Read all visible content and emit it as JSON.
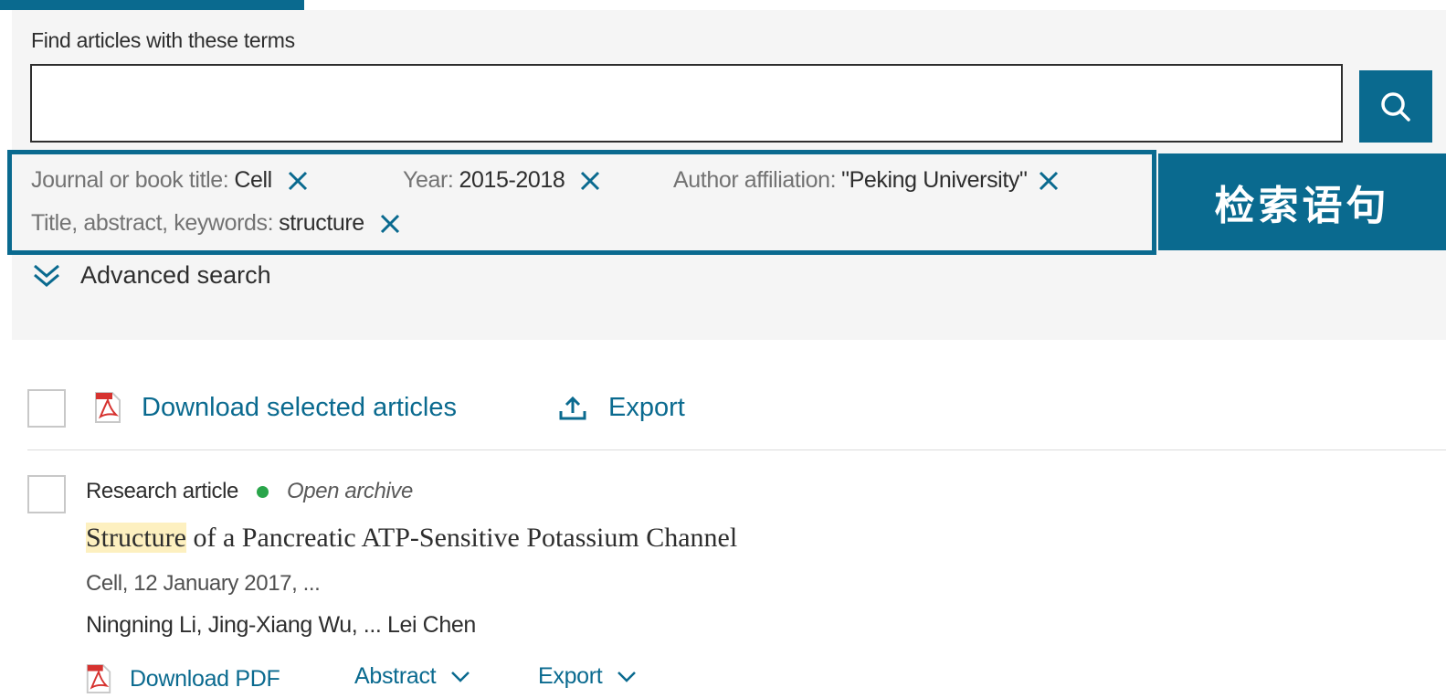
{
  "search": {
    "label": "Find articles with these terms",
    "value": "",
    "placeholder": ""
  },
  "query_chips": [
    {
      "key": "Journal or book title:",
      "value": "Cell"
    },
    {
      "key": "Year:",
      "value": "2015-2018"
    },
    {
      "key": "Author affiliation:",
      "value": "\"Peking University\""
    },
    {
      "key": "Title, abstract, keywords:",
      "value": "structure"
    }
  ],
  "callout": "检索语句",
  "advanced_search_label": "Advanced search",
  "toolbar": {
    "download_label": "Download selected articles",
    "export_label": "Export"
  },
  "result": {
    "type": "Research article",
    "access": "Open archive",
    "title_highlight": "Structure",
    "title_rest": " of a Pancreatic ATP-Sensitive Potassium Channel",
    "source": "Cell, 12 January 2017, ...",
    "authors": "Ningning Li, Jing-Xiang Wu, ... Lei Chen",
    "download_pdf_label": "Download PDF",
    "abstract_label": "Abstract",
    "export_label": "Export"
  },
  "colors": {
    "brand": "#0a6a8f",
    "open_access_dot": "#29a54a",
    "highlight": "#fdf0c0",
    "panel_bg": "#f5f5f5"
  }
}
